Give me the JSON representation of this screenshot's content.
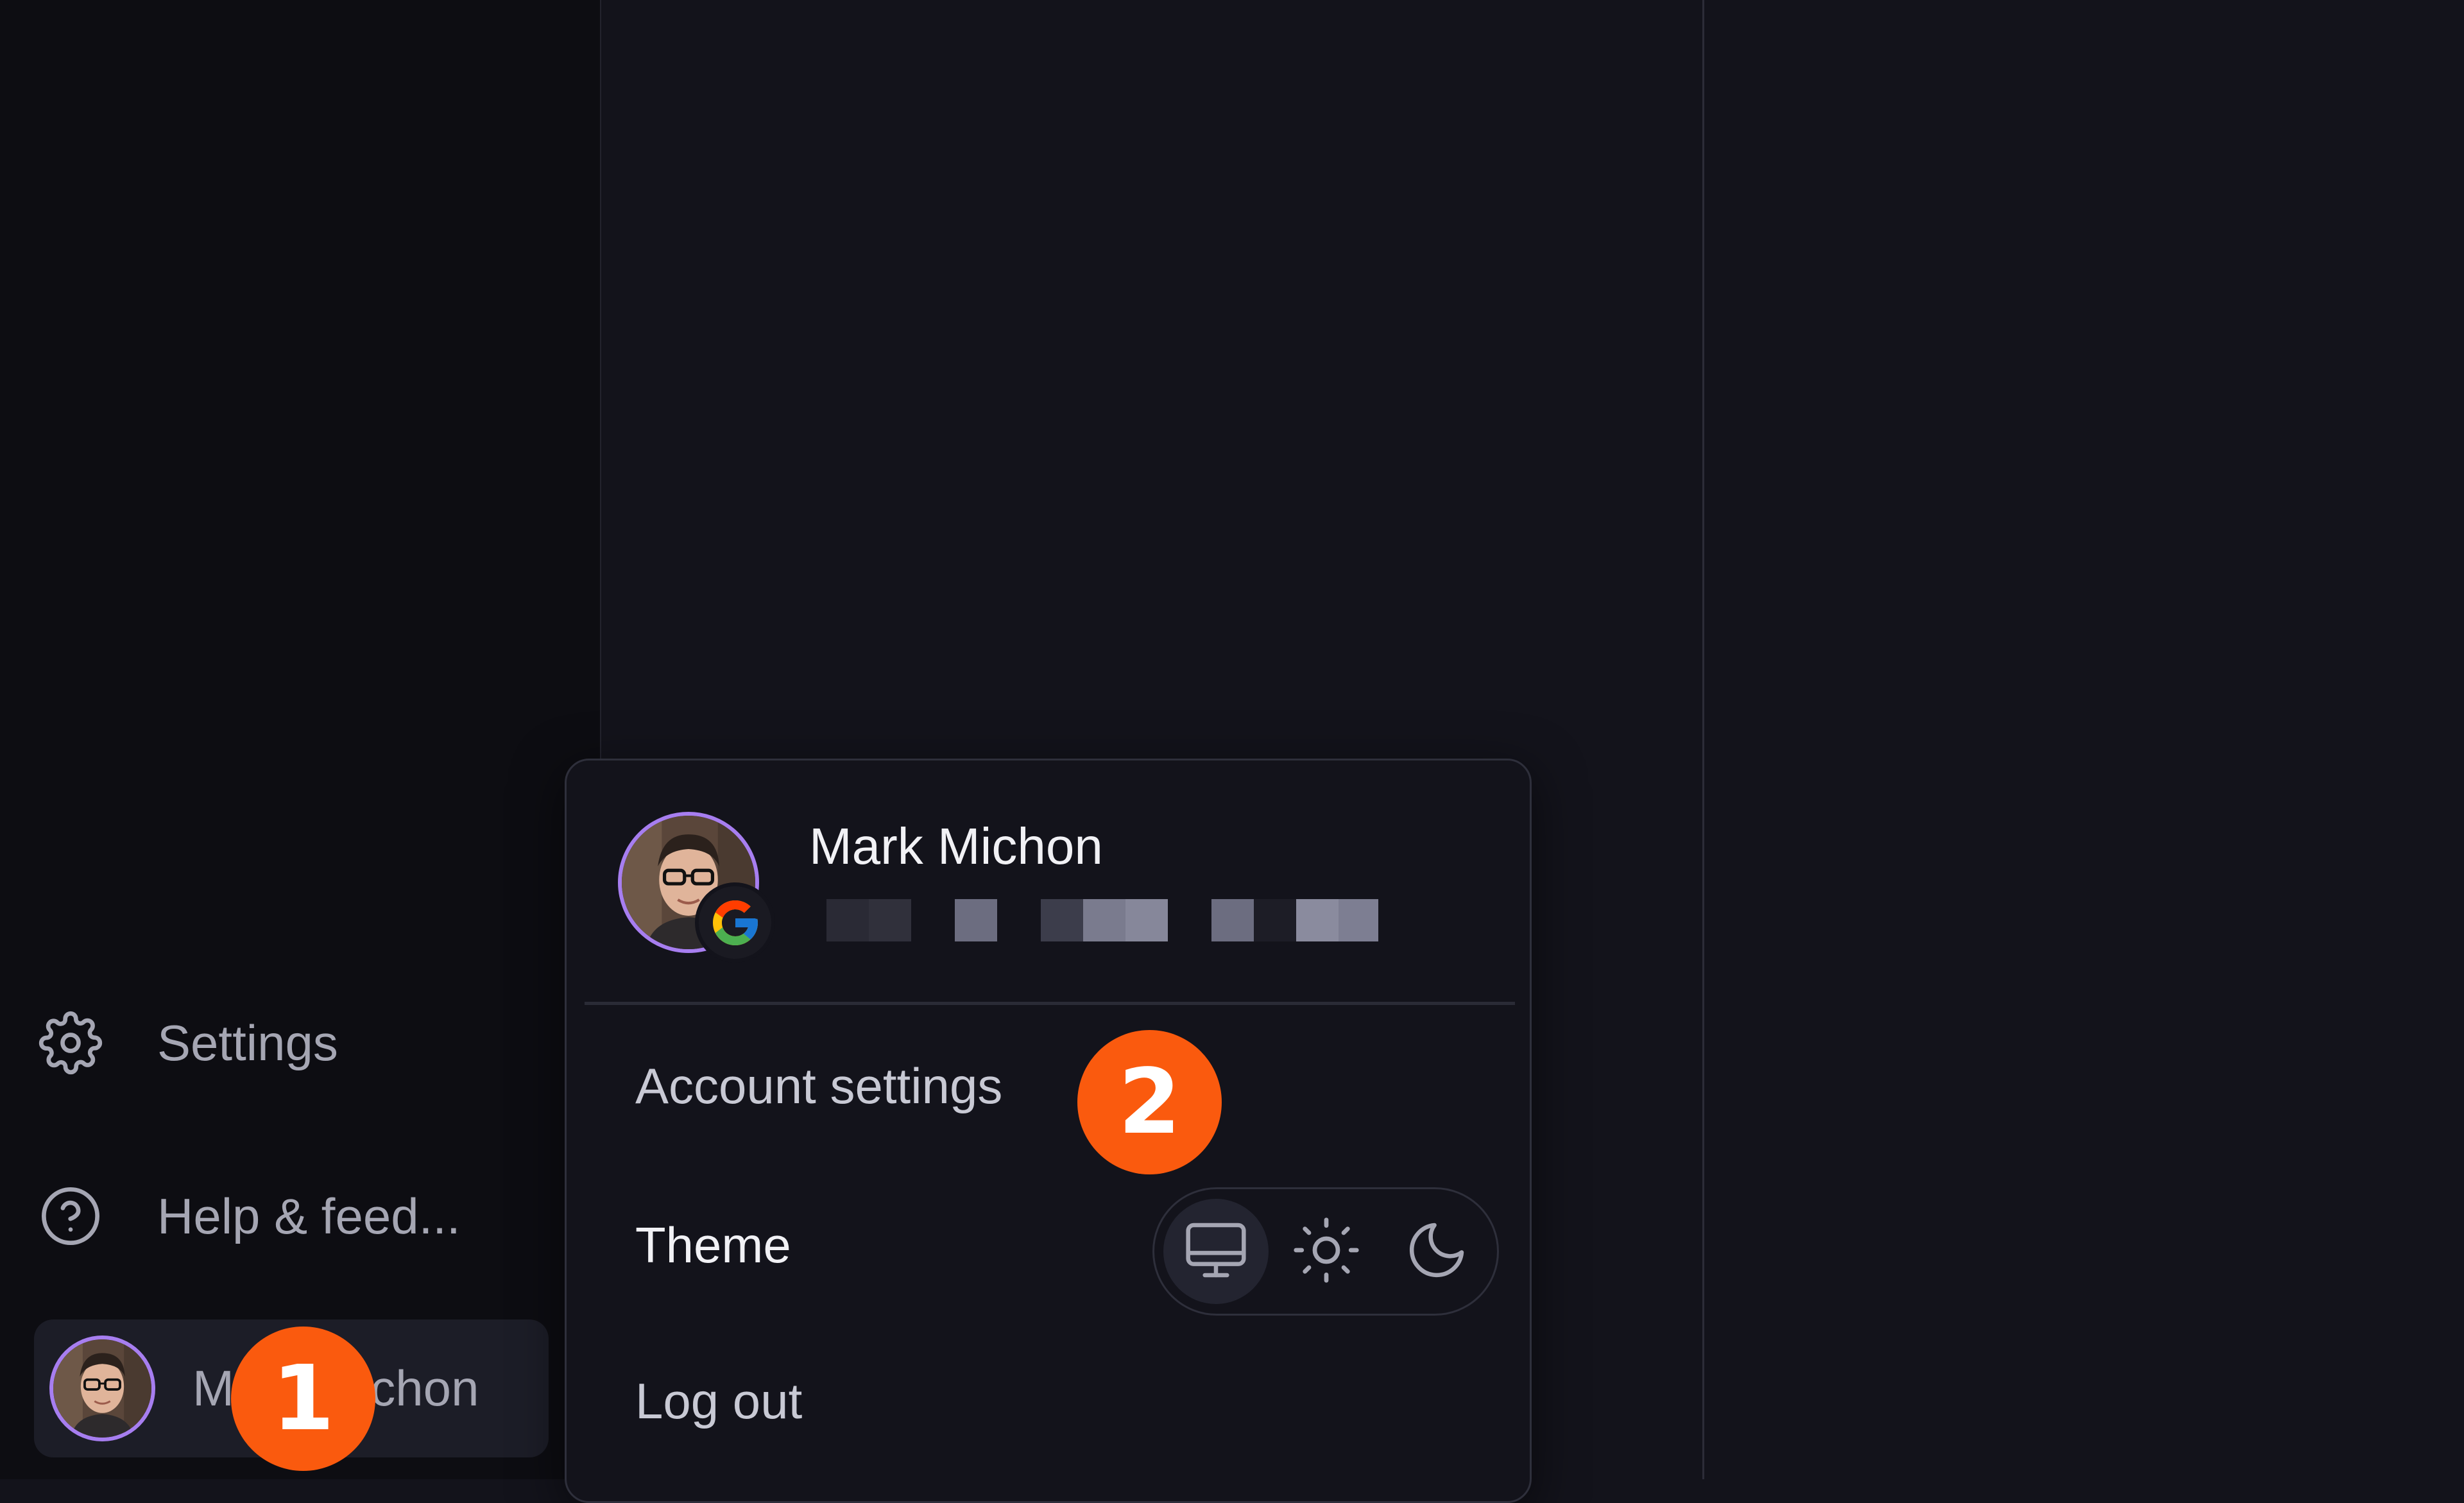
{
  "sidebar": {
    "settings_label": "Settings",
    "help_label": "Help & feed...",
    "user_label": "Mark Michon"
  },
  "account_menu": {
    "name": "Mark Michon",
    "account_settings_label": "Account settings",
    "theme_label": "Theme",
    "theme_options": [
      "monitor-icon",
      "sun-icon",
      "moon-icon"
    ],
    "theme_selected": "monitor-icon",
    "logout_label": "Log out"
  },
  "annotations": {
    "step_1": "1",
    "step_2": "2"
  },
  "colors": {
    "accent_avatar_ring": "#a77ef0",
    "step_badge": "#fa5a0e",
    "background": "#13131b",
    "sidebar_background": "#0d0d12"
  }
}
